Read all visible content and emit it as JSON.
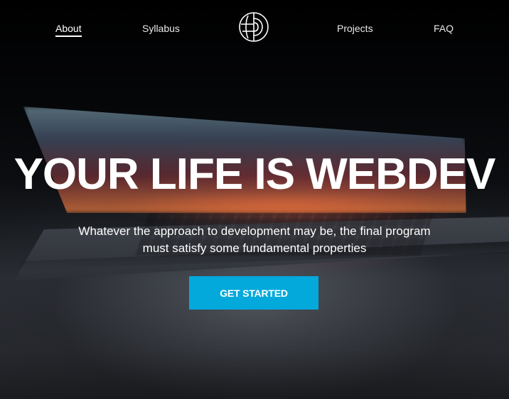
{
  "nav": {
    "items": [
      {
        "label": "About",
        "active": true
      },
      {
        "label": "Syllabus",
        "active": false
      },
      {
        "label": "Projects",
        "active": false
      },
      {
        "label": "FAQ",
        "active": false
      }
    ],
    "logo_icon": "globe-logo-icon"
  },
  "hero": {
    "headline": "YOUR LIFE IS WEBDEV",
    "subheadline": "Whatever the approach to development may be, the final program must satisfy some fundamental properties",
    "cta_label": "GET STARTED",
    "background": "laptop-photo"
  },
  "colors": {
    "accent": "#04a9dc",
    "text": "#ffffff",
    "background": "#000000"
  }
}
